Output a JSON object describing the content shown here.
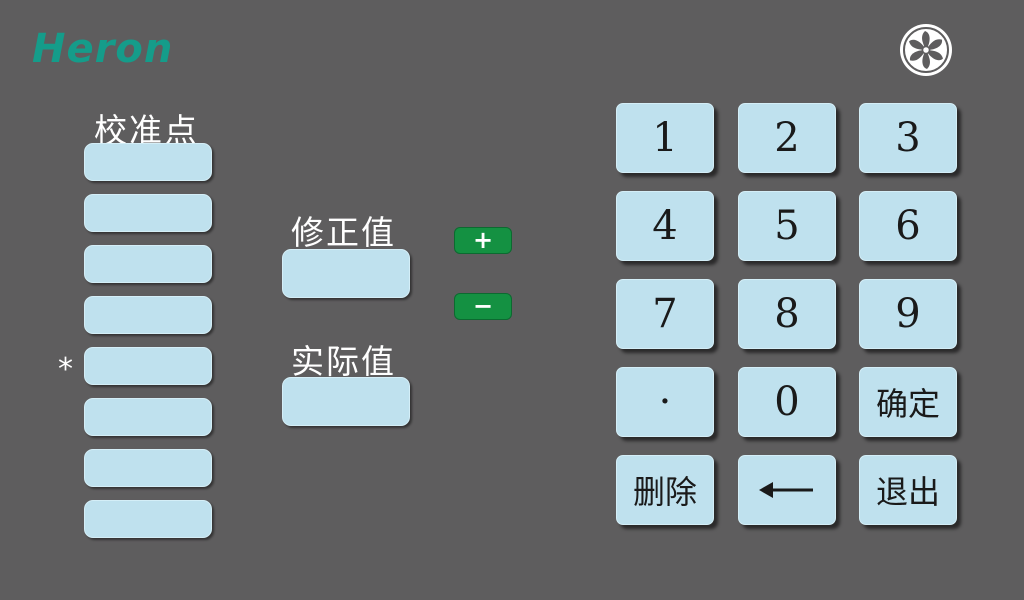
{
  "brand": {
    "logo_text": "Heron",
    "color": "#159c8a"
  },
  "icons": {
    "fan": "fan-icon",
    "backspace": "left-arrow-icon"
  },
  "left": {
    "title": "校准点",
    "selected_marker": "*",
    "fields": [
      "",
      "",
      "",
      "",
      "",
      "",
      "",
      ""
    ]
  },
  "middle": {
    "correction_label": "修正值",
    "correction_value": "",
    "actual_label": "实际值",
    "actual_value": "",
    "plus_label": "+",
    "minus_label": "−"
  },
  "keypad": {
    "keys": [
      "1",
      "2",
      "3",
      "4",
      "5",
      "6",
      "7",
      "8",
      "9",
      "·",
      "0",
      "确定",
      "删除",
      "",
      "退出"
    ]
  },
  "colors": {
    "background": "#5e5d5e",
    "key_fill": "#bfe1ee",
    "button_green": "#149142"
  }
}
